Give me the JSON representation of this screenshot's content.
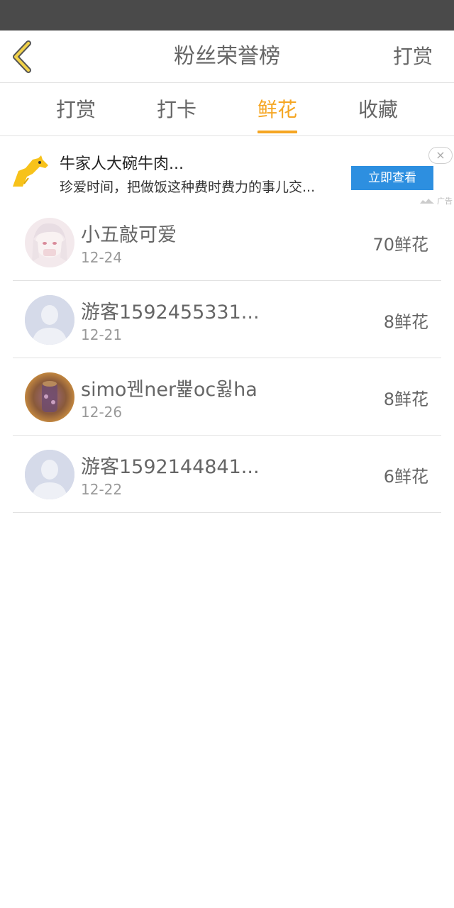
{
  "nav": {
    "title": "粉丝荣誉榜",
    "right_label": "打赏"
  },
  "tabs": [
    {
      "label": "打赏",
      "active": false
    },
    {
      "label": "打卡",
      "active": false
    },
    {
      "label": "鲜花",
      "active": true
    },
    {
      "label": "收藏",
      "active": false
    }
  ],
  "ad": {
    "title": "牛家人大碗牛肉...",
    "description": "珍爱时间，把做饭这种费时费力的事儿交...",
    "cta_label": "立即查看",
    "mark": "广告",
    "close_label": "×"
  },
  "rankings": [
    {
      "name": "小五敲可爱",
      "date": "12-24",
      "count": "70鲜花",
      "avatar": "anime-avatar"
    },
    {
      "name": "游客1592455331...",
      "date": "12-21",
      "count": "8鲜花",
      "avatar": "default-avatar"
    },
    {
      "name": "simo꿴ner쁉oc윓ha",
      "date": "12-26",
      "count": "8鲜花",
      "avatar": "photo-avatar"
    },
    {
      "name": "游客1592144841...",
      "date": "12-22",
      "count": "6鲜花",
      "avatar": "default-avatar"
    }
  ],
  "colors": {
    "accent": "#f5a623",
    "status_bar": "#4a4a4a",
    "ad_button": "#2d8fe0"
  }
}
